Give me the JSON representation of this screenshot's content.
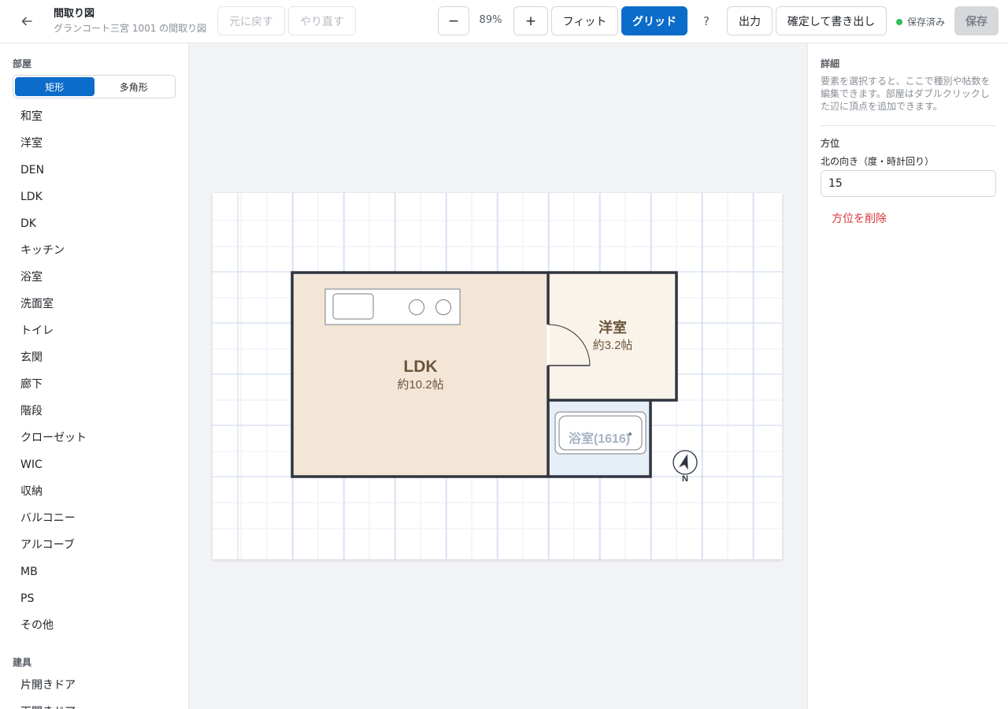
{
  "header": {
    "title": "間取り図",
    "subtitle": "グランコート三宮 1001 の間取り図",
    "undo_label": "元に戻す",
    "redo_label": "やり直す",
    "zoom_out_label": "−",
    "zoom_level": "89%",
    "zoom_in_label": "+",
    "fit_label": "フィット",
    "grid_label": "グリッド",
    "help_label": "?",
    "export_label": "出力",
    "confirm_label": "確定して書き出し",
    "saved_status": "保存済み",
    "save_label": "保存",
    "back_icon": "arrow-left-icon"
  },
  "sidebar": {
    "rooms_heading": "部屋",
    "shape_modes": [
      "矩形",
      "多角形"
    ],
    "active_mode": "矩形",
    "room_types": [
      "和室",
      "洋室",
      "DEN",
      "LDK",
      "DK",
      "キッチン",
      "浴室",
      "洗面室",
      "トイレ",
      "玄関",
      "廊下",
      "階段",
      "クローゼット",
      "WIC",
      "収納",
      "バルコニー",
      "アルコーブ",
      "MB",
      "PS",
      "その他"
    ],
    "fixtures_heading": "建具",
    "fixture_types": [
      "片開きドア",
      "両開きドア"
    ]
  },
  "floorplan": {
    "rooms": [
      {
        "name": "LDK",
        "area": "約10.2帖",
        "color": "#f3e6d7"
      },
      {
        "name": "洋室",
        "area": "約3.2帖",
        "color": "#faf3ea"
      },
      {
        "name": "浴室(1616)",
        "area": "",
        "color": "#e6eef7"
      }
    ],
    "compass_label": "N",
    "north_rotation_deg": 15,
    "wall_color": "#2f3540",
    "grid_color": "#c9d7ee"
  },
  "panel": {
    "details_heading": "詳細",
    "help_text": "要素を選択すると、ここで種別や帖数を編集できます。部屋はダブルクリックした辺に頂点を追加できます。",
    "orientation_heading": "方位",
    "north_label": "北の向き（度・時計回り）",
    "north_value": "15",
    "delete_orientation_label": "方位を削除"
  },
  "colors": {
    "accent": "#0b6cc9",
    "saved_dot": "#2fbe57",
    "danger": "#d9363e"
  }
}
